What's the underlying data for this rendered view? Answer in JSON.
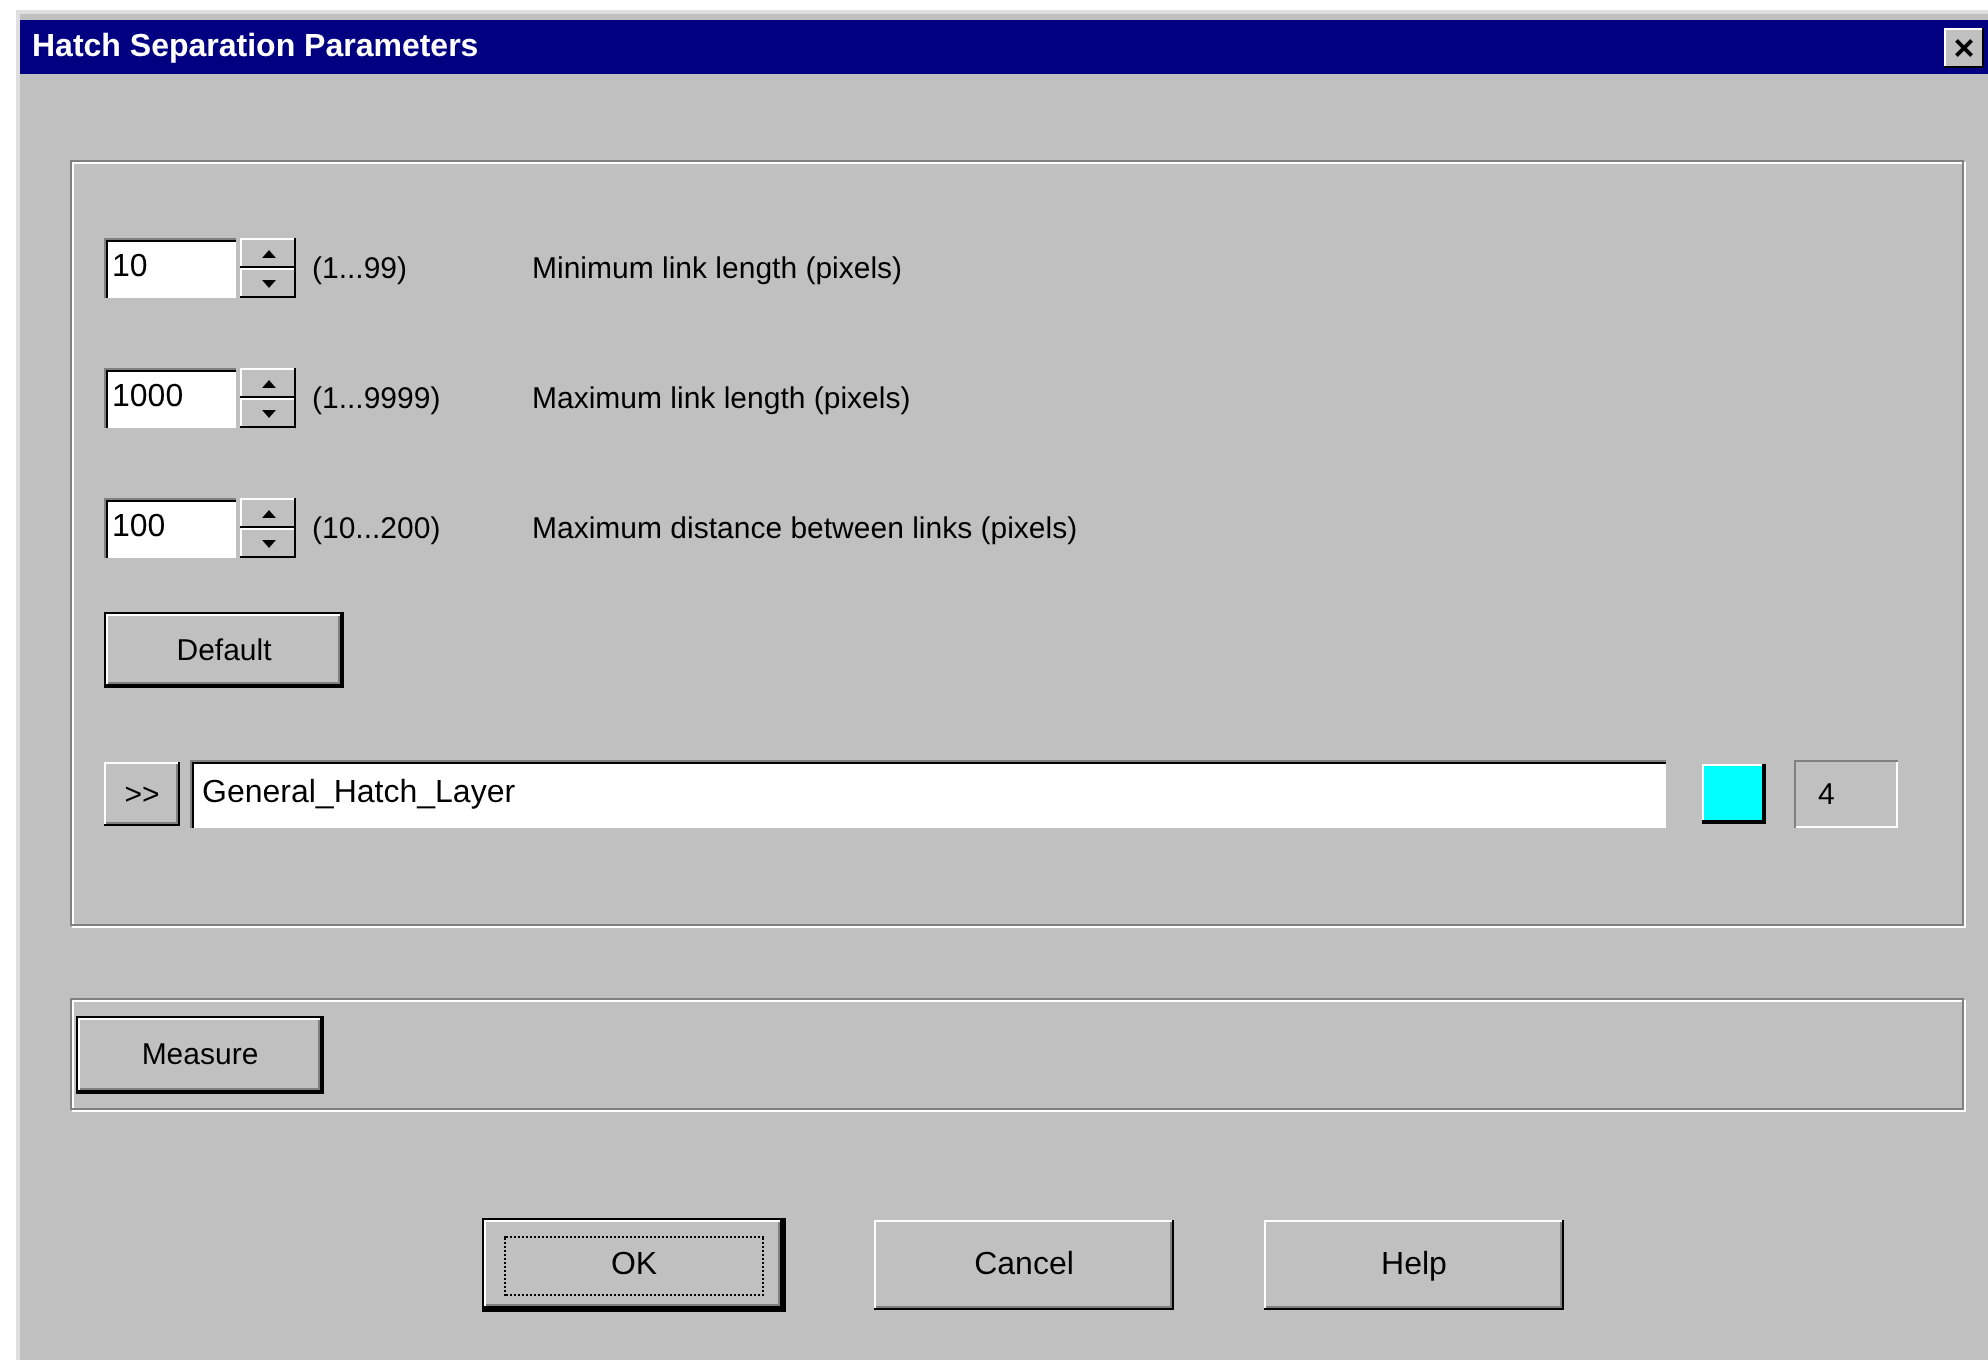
{
  "window": {
    "title": "Hatch Separation Parameters",
    "close": "×"
  },
  "parameters": [
    {
      "value": "10",
      "range": "(1...99)",
      "label": "Minimum link length (pixels)"
    },
    {
      "value": "1000",
      "range": "(1...9999)",
      "label": "Maximum link length (pixels)"
    },
    {
      "value": "100",
      "range": "(10...200)",
      "label": "Maximum distance between links (pixels)"
    }
  ],
  "default_button": "Default",
  "layer": {
    "browse": ">>",
    "name": "General_Hatch_Layer",
    "color": "#00ffff",
    "color_index": "4"
  },
  "measure_button": "Measure",
  "buttons": [
    {
      "label": "OK",
      "default": true
    },
    {
      "label": "Cancel",
      "default": false
    },
    {
      "label": "Help",
      "default": false
    }
  ]
}
